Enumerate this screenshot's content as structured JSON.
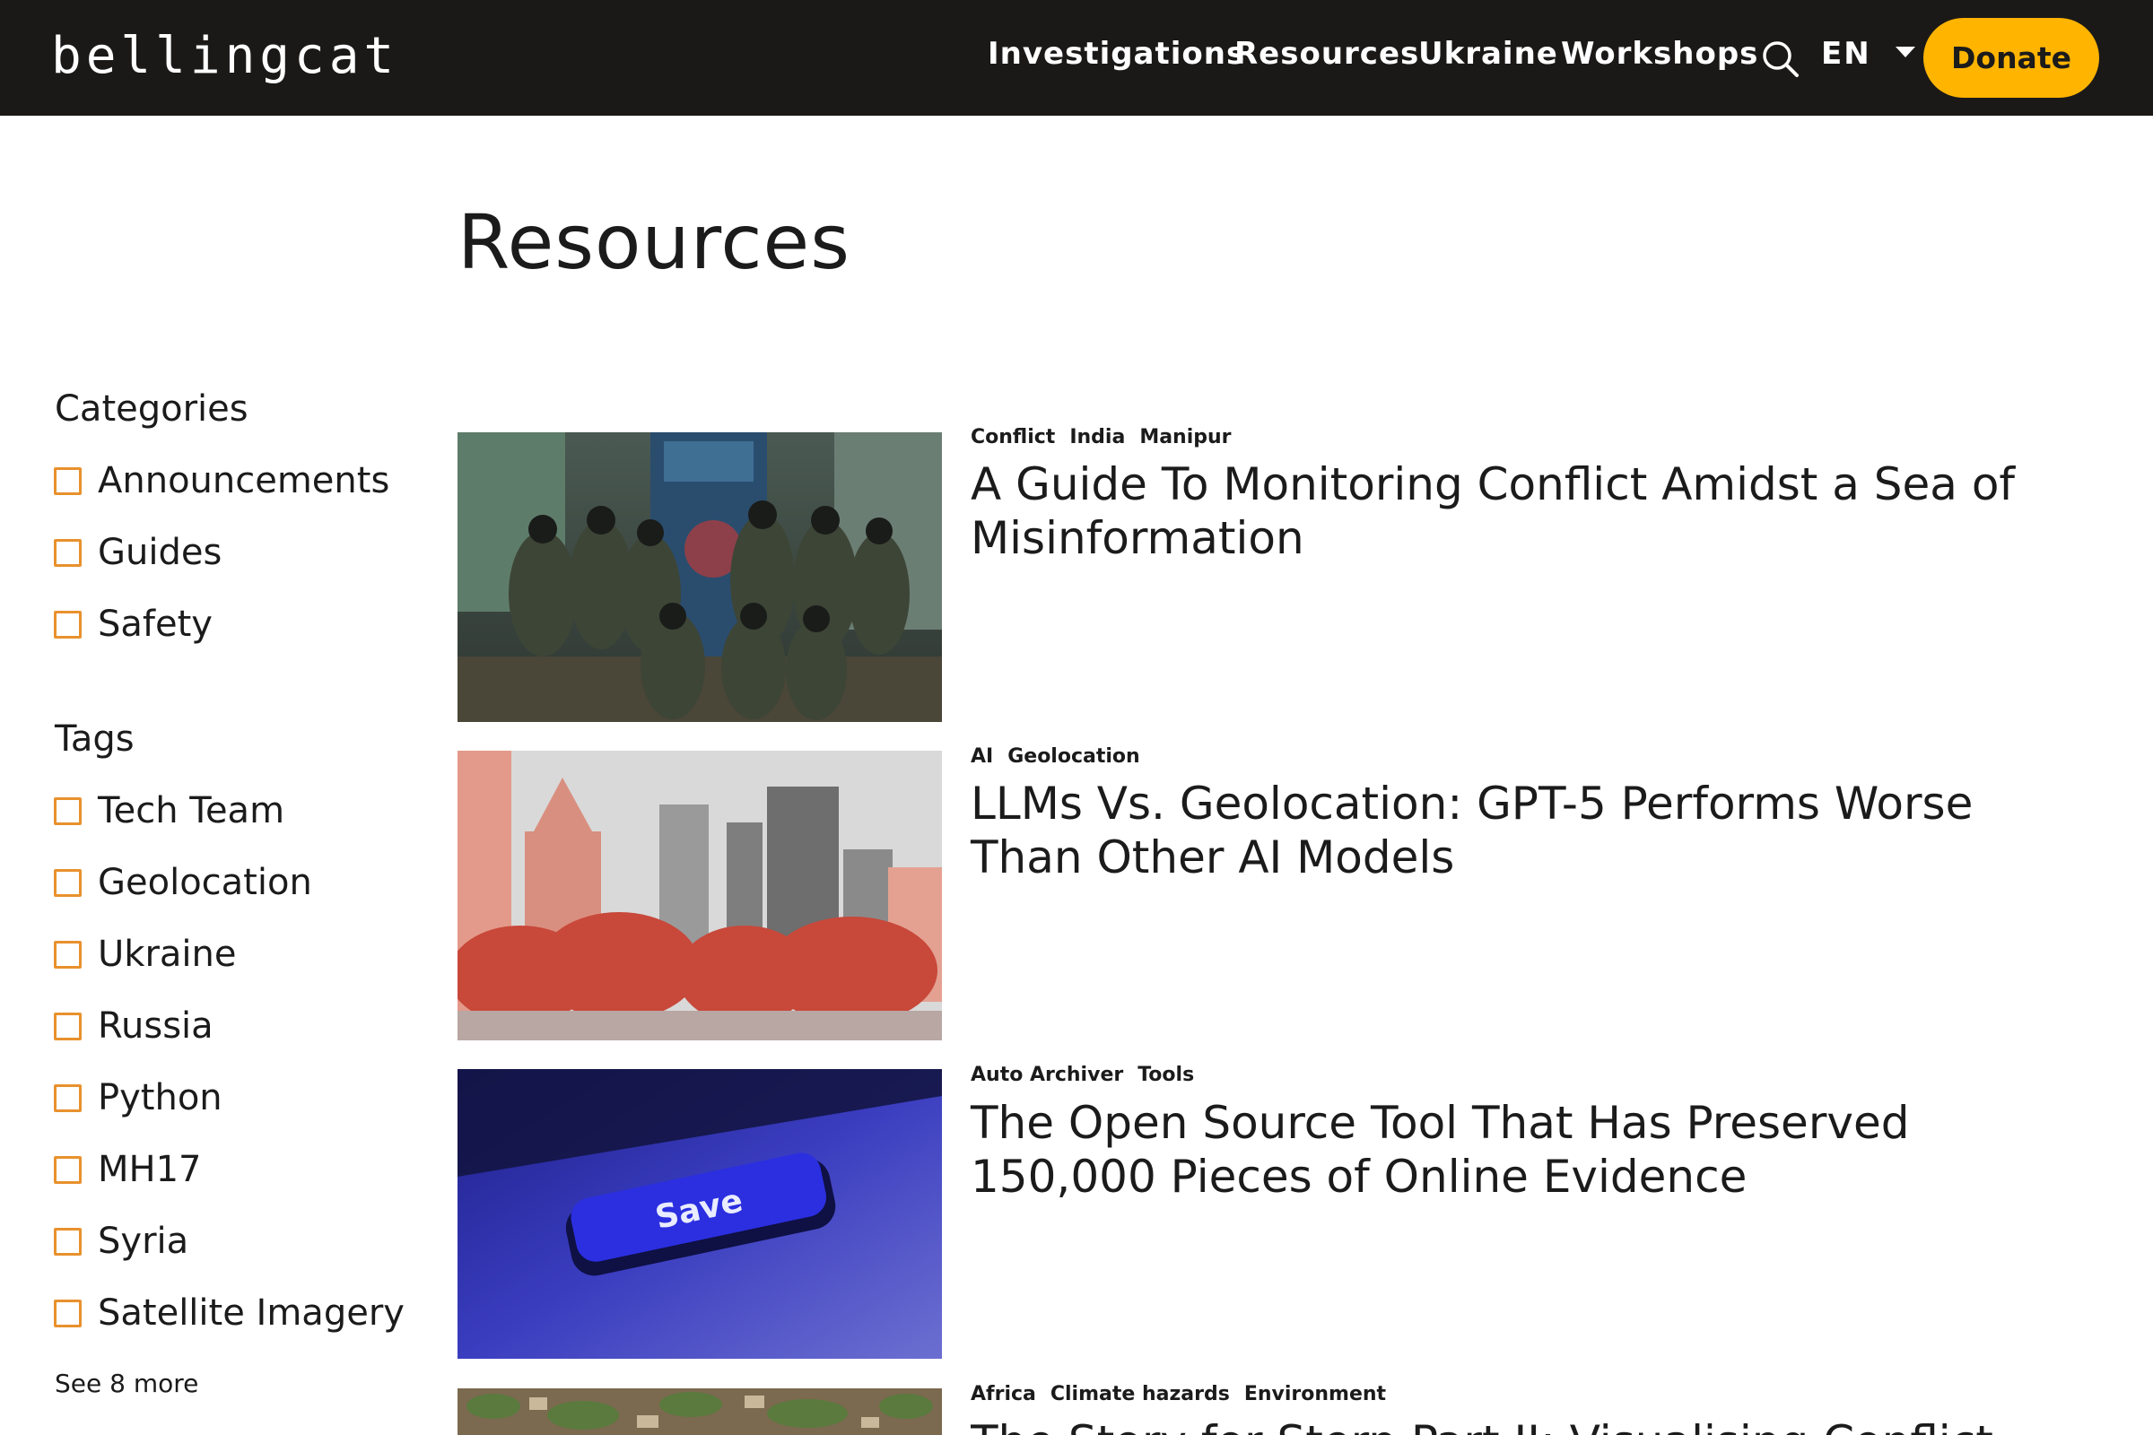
{
  "header": {
    "logo": "bellingcat",
    "nav": [
      "Investigations",
      "Resources",
      "Ukraine",
      "Workshops"
    ],
    "search_icon": "search-icon",
    "language": "EN",
    "donate_label": "Donate",
    "colors": {
      "background": "#1b1918",
      "donate": "#ffb400",
      "text": "#ffffff"
    }
  },
  "page": {
    "title": "Resources"
  },
  "sidebar": {
    "categories_heading": "Categories",
    "categories": [
      "Announcements",
      "Guides",
      "Safety"
    ],
    "tags_heading": "Tags",
    "tags": [
      "Tech Team",
      "Geolocation",
      "Ukraine",
      "Russia",
      "Python",
      "MH17",
      "Syria",
      "Satellite Imagery"
    ],
    "see_more": "See 8 more",
    "checkbox_color": "#e8912d"
  },
  "articles": [
    {
      "tags": [
        "Conflict",
        "India",
        "Manipur"
      ],
      "title": "A Guide To Monitoring Conflict Amidst a Sea of Misinformation"
    },
    {
      "tags": [
        "AI",
        "Geolocation"
      ],
      "title": "LLMs Vs. Geolocation: GPT-5 Performs Worse Than Other AI Models"
    },
    {
      "tags": [
        "Auto Archiver",
        "Tools"
      ],
      "title": "The Open Source Tool That Has Preserved 150,000 Pieces of Online Evidence",
      "image_text": "Save"
    },
    {
      "tags": [
        "Africa",
        "Climate hazards",
        "Environment"
      ],
      "title": "The Story for Stern Part II: Visualising Conflict"
    }
  ]
}
